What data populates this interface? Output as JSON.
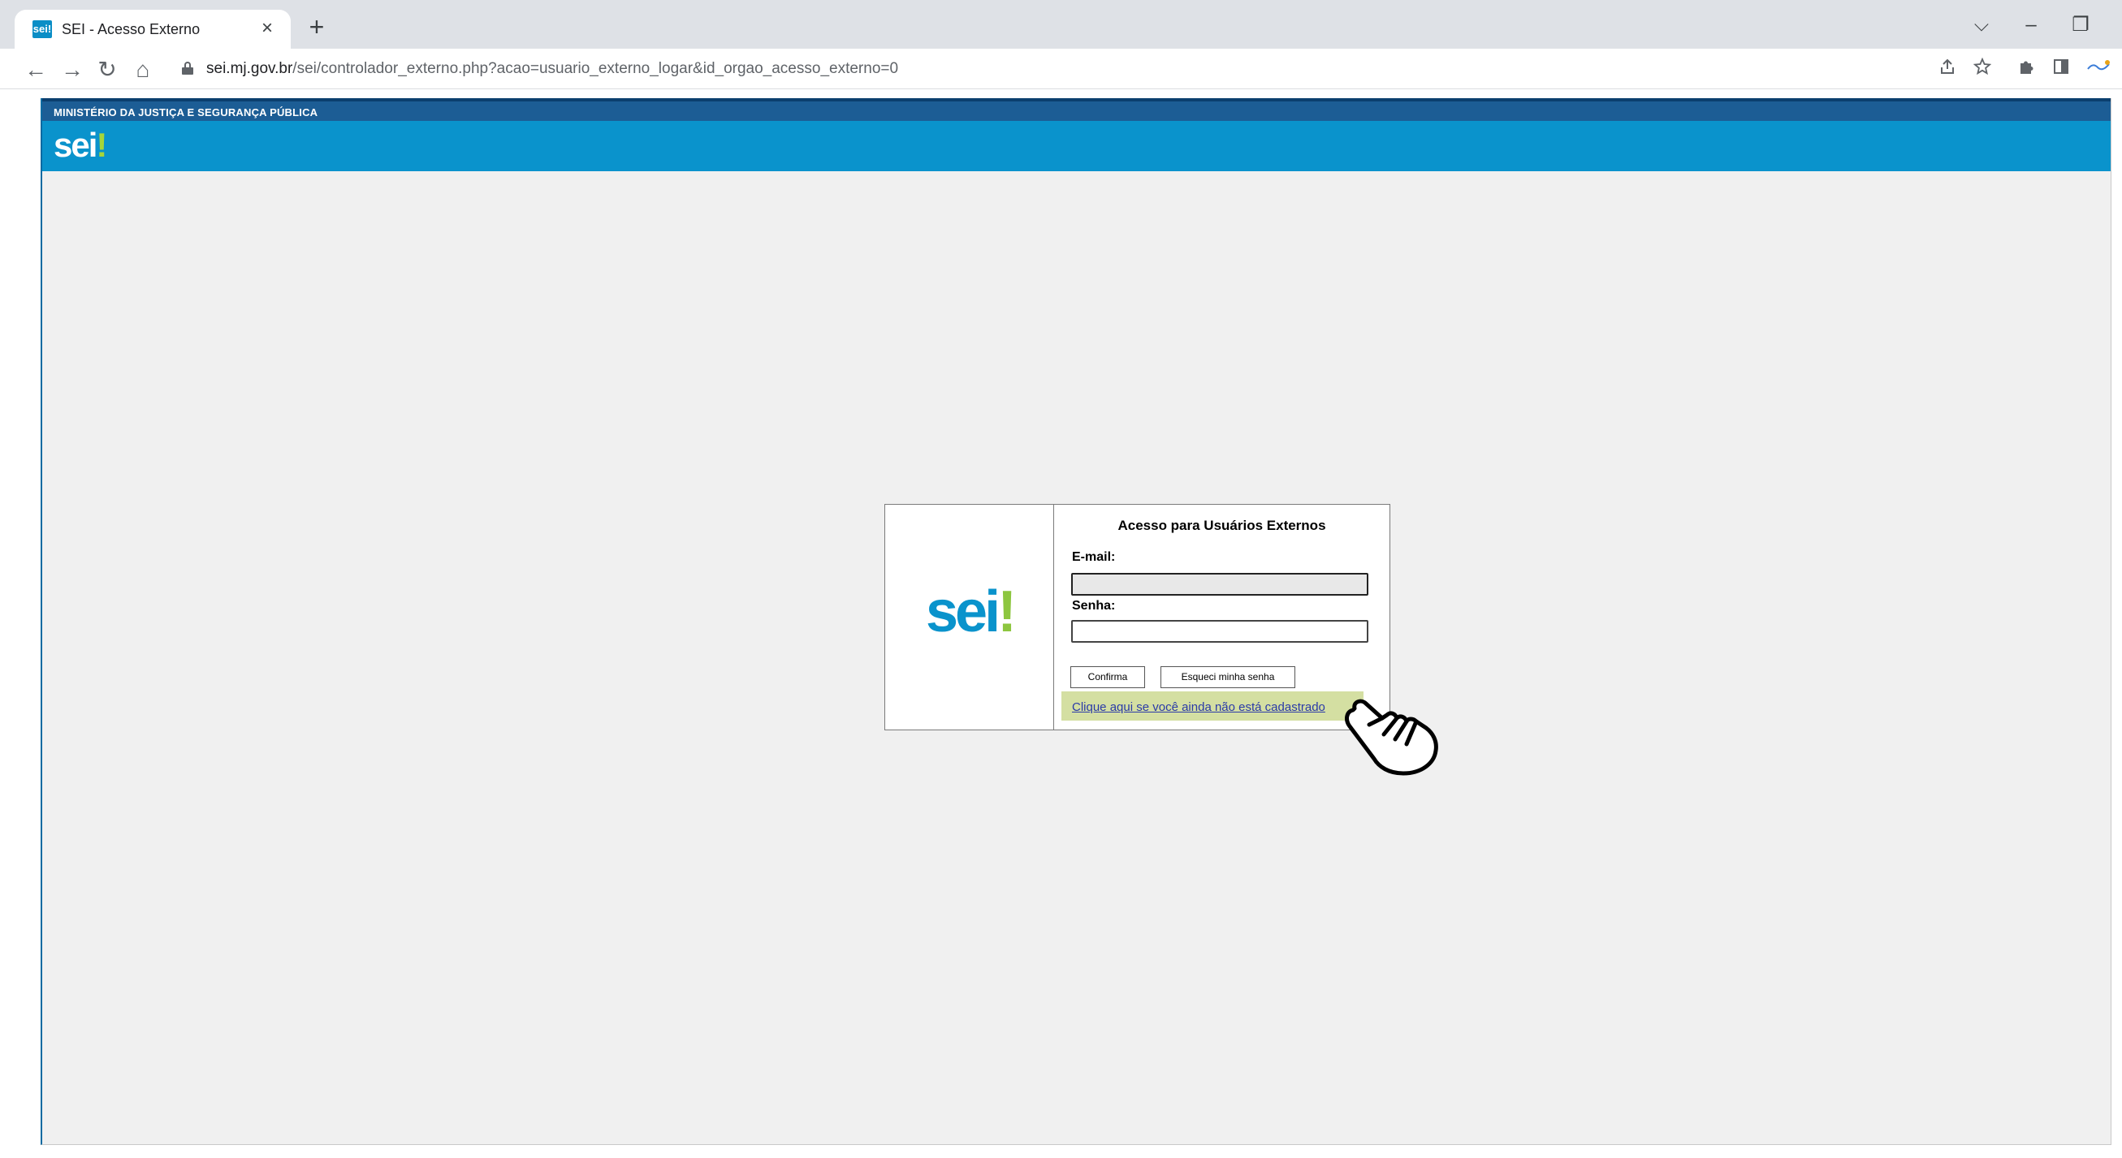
{
  "browser": {
    "tab": {
      "title": "SEI - Acesso Externo",
      "favicon_text": "sei!",
      "close": "×"
    },
    "new_tab": "+",
    "window_controls": {
      "tab_search": "⌵",
      "minimize": "–",
      "restore": "❐"
    },
    "nav": {
      "back": "←",
      "forward": "→",
      "reload": "↻",
      "home": "⌂"
    },
    "address": {
      "host": "sei.mj.gov.br",
      "path": "/sei/controlador_externo.php?acao=usuario_externo_logar&id_orgao_acesso_externo=0"
    },
    "toolbar_icons": [
      "share-icon",
      "star-icon",
      "puzzle-icon",
      "sidebar-icon",
      "extension-icon"
    ]
  },
  "header": {
    "org": "MINISTÉRIO DA JUSTIÇA E SEGURANÇA PÚBLICA",
    "logo_text": "sei",
    "logo_bang": "!"
  },
  "login": {
    "logo_text": "sei",
    "logo_bang": "!",
    "title": "Acesso para Usuários Externos",
    "email_label": "E-mail:",
    "email_value": "",
    "password_label": "Senha:",
    "password_value": "",
    "confirm_button": "Confirma",
    "forgot_button": "Esqueci minha senha",
    "register_link": "Clique aqui se você ainda não está cadastrado"
  },
  "colors": {
    "header_dark": "#1c5d95",
    "header_bar": "#0a93cc",
    "logo_accent": "#8dc63f",
    "highlight": "#d4dfa2",
    "link": "#2a3aa8"
  }
}
